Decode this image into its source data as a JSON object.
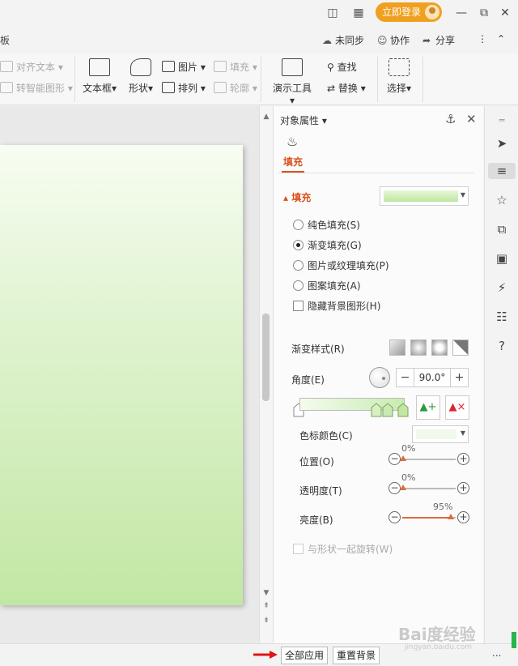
{
  "titlebar": {
    "login_label": "立即登录",
    "icons": [
      "reading-mode-icon",
      "apps-grid-icon",
      "avatar-icon",
      "minimize-icon",
      "restore-icon",
      "close-icon"
    ]
  },
  "menurow": {
    "left_label": "板",
    "unsync": "未同步",
    "collab": "协作",
    "share": "分享"
  },
  "ribbon": {
    "align_text": "对齐文本",
    "smart_shape": "转智能图形",
    "textbox": "文本框",
    "shape": "形状",
    "picture": "图片",
    "arrange": "排列",
    "fill": "填充",
    "outline": "轮廓",
    "present_tool": "演示工具",
    "find": "查找",
    "replace": "替换",
    "select": "选择"
  },
  "panel": {
    "title": "对象属性",
    "tab": "填充",
    "section": "填充",
    "options": {
      "solid": "纯色填充(S)",
      "gradient": "渐变填充(G)",
      "picture": "图片或纹理填充(P)",
      "pattern": "图案填充(A)",
      "hide_bg": "隐藏背景图形(H)"
    },
    "selected_option": "gradient",
    "gradient_style_label": "渐变样式(R)",
    "angle_label": "角度(E)",
    "angle_value": "90.0°",
    "stop_color_label": "色标颜色(C)",
    "position_label": "位置(O)",
    "position_value": "0%",
    "transparency_label": "透明度(T)",
    "transparency_value": "0%",
    "brightness_label": "亮度(B)",
    "brightness_value": "95%",
    "rotate_label": "与形状一起旋转(W)",
    "colors": {
      "accent": "#d9531e",
      "gradient_start": "#f4fbee",
      "gradient_end": "#c2e7a4"
    }
  },
  "bottom": {
    "apply_all": "全部应用",
    "reset_bg": "重置背景",
    "more": "..."
  },
  "watermark": {
    "main": "Bai度经验",
    "sub": "jingyan.baidu.com"
  }
}
